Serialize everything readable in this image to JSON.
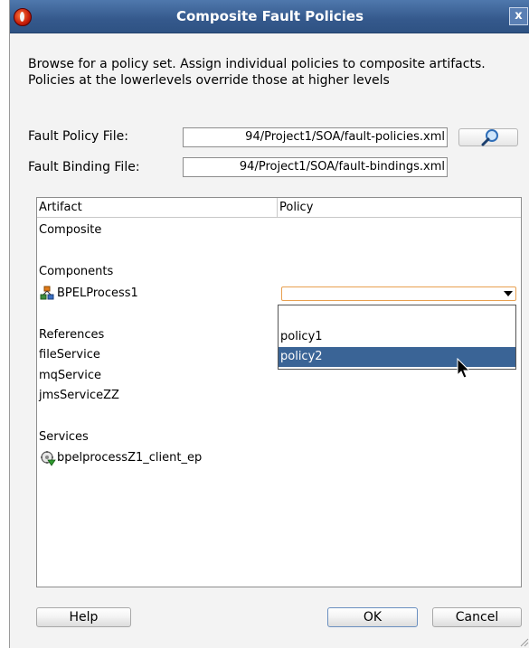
{
  "window": {
    "title": "Composite Fault Policies",
    "close_glyph": "x"
  },
  "instructions": "Browse for a policy set. Assign individual policies to composite artifacts. Policies at the lowerlevels override those at higher levels",
  "fields": {
    "fault_policy_file": {
      "label": "Fault Policy File:",
      "value": "94/Project1/SOA/fault-policies.xml"
    },
    "fault_binding_file": {
      "label": "Fault Binding File:",
      "value": "94/Project1/SOA/fault-bindings.xml"
    }
  },
  "table": {
    "columns": [
      "Artifact",
      "Policy"
    ],
    "rows": {
      "composite": "Composite",
      "components_header": "Components",
      "bpel_process": "BPELProcess1",
      "references_header": "References",
      "ref_file_service": "fileService",
      "ref_mq_service": "mqService",
      "ref_jms_service": "jmsServiceZZ",
      "services_header": "Services",
      "service_client_ep": "bpelprocessZ1_client_ep"
    }
  },
  "policy_dropdown": {
    "selected": "",
    "options": [
      "",
      "policy1",
      "policy2"
    ],
    "highlighted": "policy2"
  },
  "buttons": {
    "help": "Help",
    "ok": "OK",
    "cancel": "Cancel"
  },
  "icons": {
    "search": "magnifier-icon",
    "component": "bpel-process-icon",
    "service": "web-service-icon"
  },
  "colors": {
    "titlebar": "#35598c",
    "selection": "#3a6496",
    "combo_border": "#e8a050"
  }
}
